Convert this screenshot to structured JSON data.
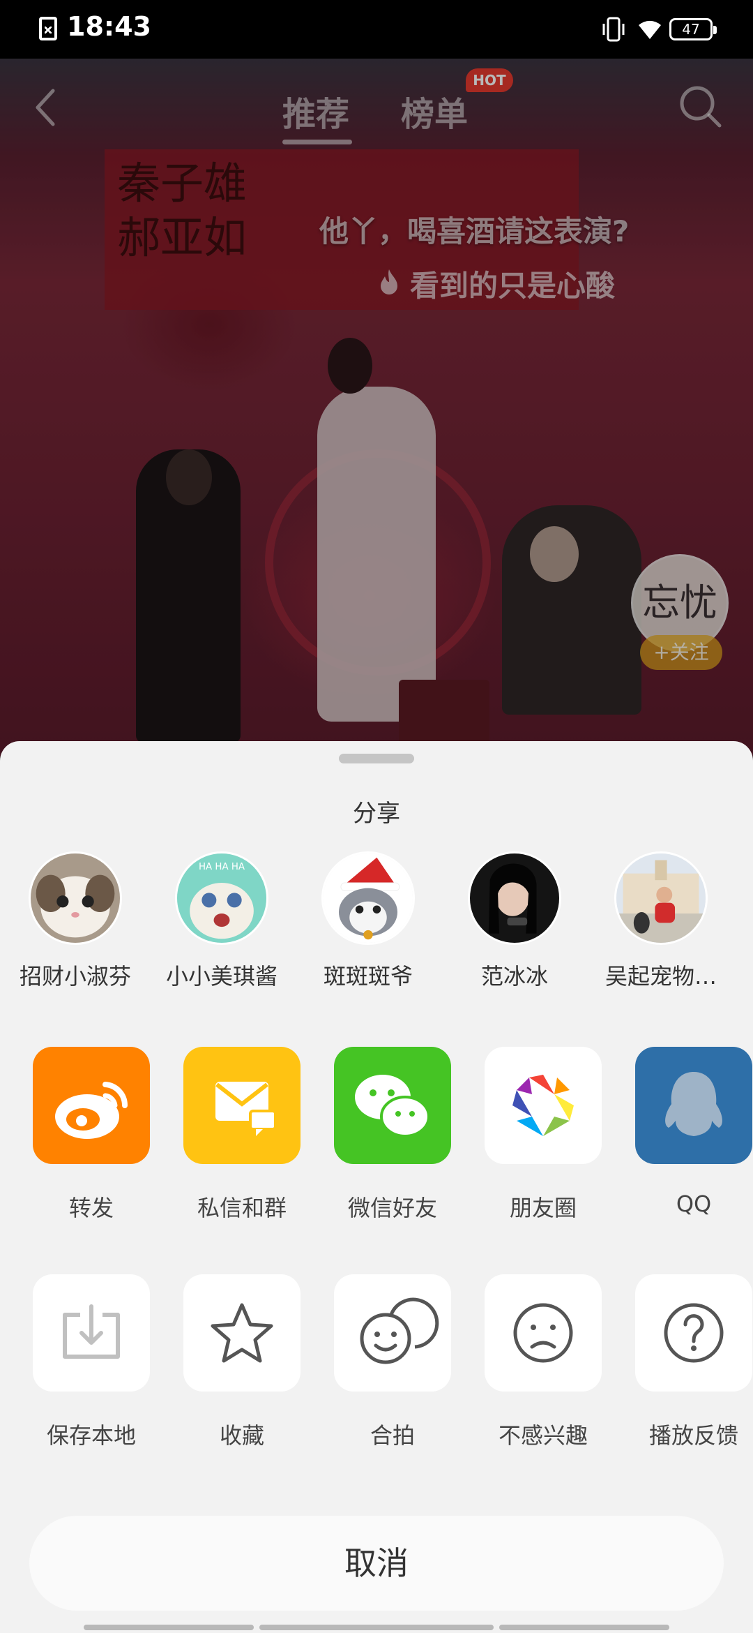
{
  "status_bar": {
    "time": "18:43",
    "battery": "47"
  },
  "nav": {
    "tabs": [
      {
        "label": "推荐",
        "active": true
      },
      {
        "label": "榜单",
        "active": false
      }
    ],
    "hot_badge": "HOT"
  },
  "video": {
    "title": "他丫，喝喜酒请这表演?",
    "subtitle": "看到的只是心酸",
    "author_badge": "忘忧",
    "follow_label": "+关注",
    "banner_text": [
      "秦子雄",
      "郝亚如"
    ]
  },
  "share_sheet": {
    "title": "分享",
    "contacts": [
      {
        "name": "招财小淑芬"
      },
      {
        "name": "小小美琪酱"
      },
      {
        "name": "斑斑斑爷"
      },
      {
        "name": "范冰冰"
      },
      {
        "name": "吴起宠物…"
      }
    ],
    "share_targets": [
      {
        "label": "转发",
        "icon": "weibo-icon",
        "color": "#ff8200"
      },
      {
        "label": "私信和群",
        "icon": "mail-icon",
        "color": "#ffc312"
      },
      {
        "label": "微信好友",
        "icon": "wechat-icon",
        "color": "#45c424"
      },
      {
        "label": "朋友圈",
        "icon": "moments-icon",
        "color": "#ffffff"
      },
      {
        "label": "QQ",
        "icon": "qq-icon",
        "color": "#2e6fa8"
      }
    ],
    "actions": [
      {
        "label": "保存本地",
        "icon": "download-icon"
      },
      {
        "label": "收藏",
        "icon": "star-icon"
      },
      {
        "label": "合拍",
        "icon": "duet-icon"
      },
      {
        "label": "不感兴趣",
        "icon": "sad-face-icon"
      },
      {
        "label": "播放反馈",
        "icon": "question-icon"
      }
    ],
    "cancel_label": "取消"
  }
}
